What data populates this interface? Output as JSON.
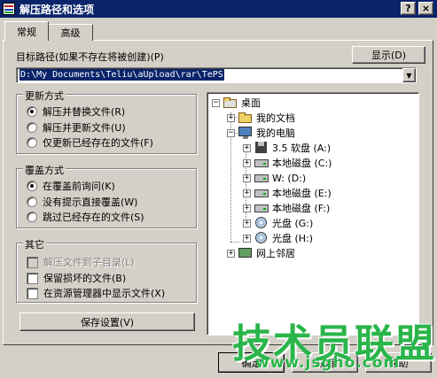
{
  "window": {
    "title": "解压路径和选项",
    "help_label": "?",
    "close_label": "×"
  },
  "tabs": [
    {
      "label": "常规",
      "active": true
    },
    {
      "label": "高级",
      "active": false
    }
  ],
  "target_path": {
    "label": "目标路径(如果不存在将被创建)(P)",
    "value": "D:\\My Documents\\Teliu\\aUpload\\rar\\TePS",
    "show_button": "显示(D)"
  },
  "update_mode": {
    "label": "更新方式",
    "options": [
      {
        "label": "解压并替换文件(R)",
        "checked": true
      },
      {
        "label": "解压并更新文件(U)",
        "checked": false
      },
      {
        "label": "仅更新已经存在的文件(F)",
        "checked": false
      }
    ]
  },
  "overwrite_mode": {
    "label": "覆盖方式",
    "options": [
      {
        "label": "在覆盖前询问(K)",
        "checked": true
      },
      {
        "label": "没有提示直接覆盖(W)",
        "checked": false
      },
      {
        "label": "跳过已经存在的文件(S)",
        "checked": false
      }
    ]
  },
  "misc": {
    "label": "其它",
    "options": [
      {
        "label": "解压文件到子目录(L)",
        "checked": false,
        "disabled": true
      },
      {
        "label": "保留损坏的文件(B)",
        "checked": false,
        "disabled": false
      },
      {
        "label": "在资源管理器中显示文件(X)",
        "checked": false,
        "disabled": false
      }
    ]
  },
  "save_button": "保存设置(V)",
  "tree": {
    "root": "桌面",
    "my_documents": "我的文档",
    "my_computer": "我的电脑",
    "drives": [
      {
        "label": "3.5 软盘 (A:)",
        "icon": "floppy-icon"
      },
      {
        "label": "本地磁盘 (C:)",
        "icon": "hard-drive-icon"
      },
      {
        "label": "W: (D:)",
        "icon": "hard-drive-icon"
      },
      {
        "label": "本地磁盘 (E:)",
        "icon": "hard-drive-icon"
      },
      {
        "label": "本地磁盘 (F:)",
        "icon": "hard-drive-icon"
      },
      {
        "label": "光盘 (G:)",
        "icon": "cd-drive-icon"
      },
      {
        "label": "光盘 (H:)",
        "icon": "cd-drive-icon"
      }
    ],
    "network": "网上邻居"
  },
  "buttons": {
    "ok": "确定",
    "cancel": "取消",
    "help": "帮助"
  },
  "watermark": {
    "brand": "技术员联盟",
    "url": "www.jsgho.com"
  },
  "colors": {
    "titlebar": "#0a246a",
    "face": "#d4d0c8",
    "watermark": "#2ab54a"
  }
}
